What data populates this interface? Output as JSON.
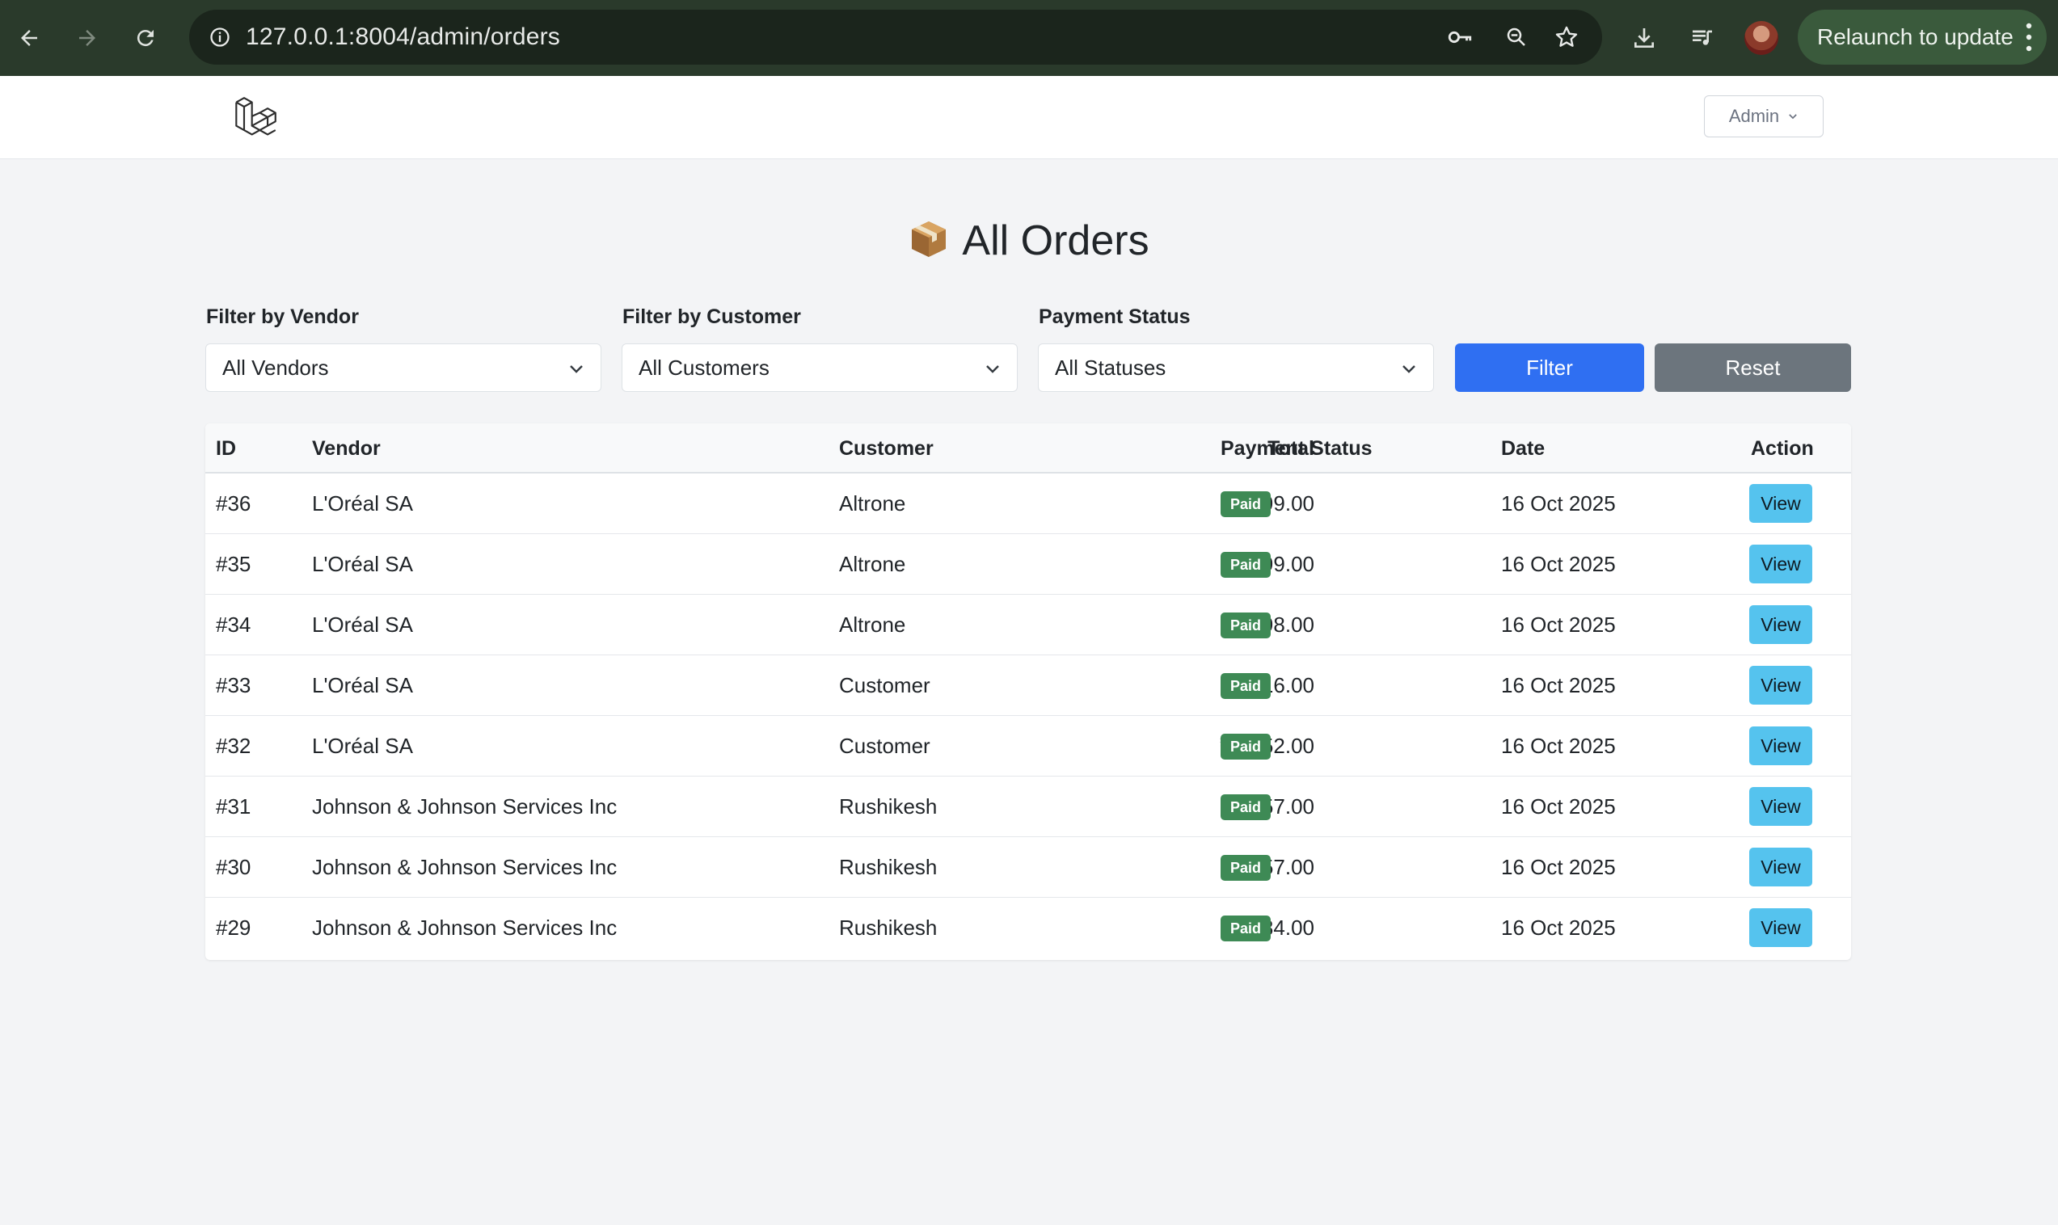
{
  "browser": {
    "url": "127.0.0.1:8004/admin/orders",
    "relaunch_label": "Relaunch to update"
  },
  "header": {
    "admin_label": "Admin"
  },
  "page": {
    "title": "All Orders"
  },
  "filters": {
    "vendor_label": "Filter by Vendor",
    "vendor_value": "All Vendors",
    "customer_label": "Filter by Customer",
    "customer_value": "All Customers",
    "status_label": "Payment Status",
    "status_value": "All Statuses",
    "filter_button": "Filter",
    "reset_button": "Reset"
  },
  "table": {
    "headers": {
      "id": "ID",
      "vendor": "Vendor",
      "customer": "Customer",
      "total": "Total",
      "status": "Payment Status",
      "date": "Date",
      "action": "Action"
    },
    "rows": [
      {
        "id": "#36",
        "vendor": "L'Oréal SA",
        "customer": "Altrone",
        "total": "₹199.00",
        "status": "Paid",
        "date": "16 Oct 2025",
        "action": "View"
      },
      {
        "id": "#35",
        "vendor": "L'Oréal SA",
        "customer": "Altrone",
        "total": "₹199.00",
        "status": "Paid",
        "date": "16 Oct 2025",
        "action": "View"
      },
      {
        "id": "#34",
        "vendor": "L'Oréal SA",
        "customer": "Altrone",
        "total": "₹398.00",
        "status": "Paid",
        "date": "16 Oct 2025",
        "action": "View"
      },
      {
        "id": "#33",
        "vendor": "L'Oréal SA",
        "customer": "Customer",
        "total": "₹416.00",
        "status": "Paid",
        "date": "16 Oct 2025",
        "action": "View"
      },
      {
        "id": "#32",
        "vendor": "L'Oréal SA",
        "customer": "Customer",
        "total": "₹2,052.00",
        "status": "Paid",
        "date": "16 Oct 2025",
        "action": "View"
      },
      {
        "id": "#31",
        "vendor": "Johnson & Johnson Services Inc",
        "customer": "Rushikesh",
        "total": "₹257.00",
        "status": "Paid",
        "date": "16 Oct 2025",
        "action": "View"
      },
      {
        "id": "#30",
        "vendor": "Johnson & Johnson Services Inc",
        "customer": "Rushikesh",
        "total": "₹257.00",
        "status": "Paid",
        "date": "16 Oct 2025",
        "action": "View"
      },
      {
        "id": "#29",
        "vendor": "Johnson & Johnson Services Inc",
        "customer": "Rushikesh",
        "total": "₹384.00",
        "status": "Paid",
        "date": "16 Oct 2025",
        "action": "View"
      }
    ]
  },
  "colors": {
    "primary": "#2f6ff2",
    "secondary": "#6c757d",
    "success": "#3e8a55",
    "info": "#55c3ee"
  },
  "icons": [
    "back-arrow-icon",
    "forward-arrow-icon",
    "reload-icon",
    "site-info-icon",
    "key-icon",
    "zoom-icon",
    "star-icon",
    "download-icon",
    "media-queue-icon",
    "avatar",
    "more-vert-icon",
    "laravel-logo",
    "package-icon",
    "chevron-down-icon"
  ]
}
